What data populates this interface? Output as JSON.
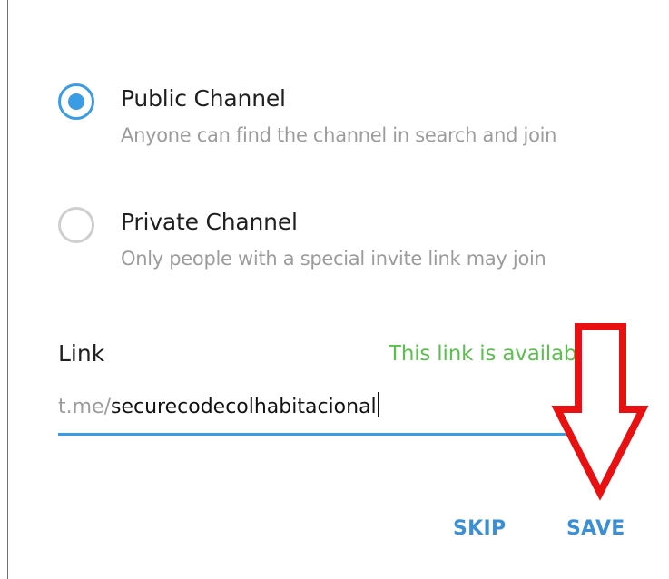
{
  "channel_type": {
    "public": {
      "title": "Public Channel",
      "description": "Anyone can find the channel in search and join",
      "selected": true
    },
    "private": {
      "title": "Private Channel",
      "description": "Only people with a special invite link may join",
      "selected": false
    }
  },
  "link": {
    "label": "Link",
    "status": "This link is available",
    "prefix": "t.me/",
    "value": "securecodecolhabitacional"
  },
  "actions": {
    "skip_label": "SKIP",
    "save_label": "SAVE"
  },
  "annotation": {
    "type": "down-arrow",
    "color": "#e81010"
  },
  "colors": {
    "accent": "#3a9ce5",
    "success": "#5bbf4e",
    "muted": "#9c9c9c"
  }
}
